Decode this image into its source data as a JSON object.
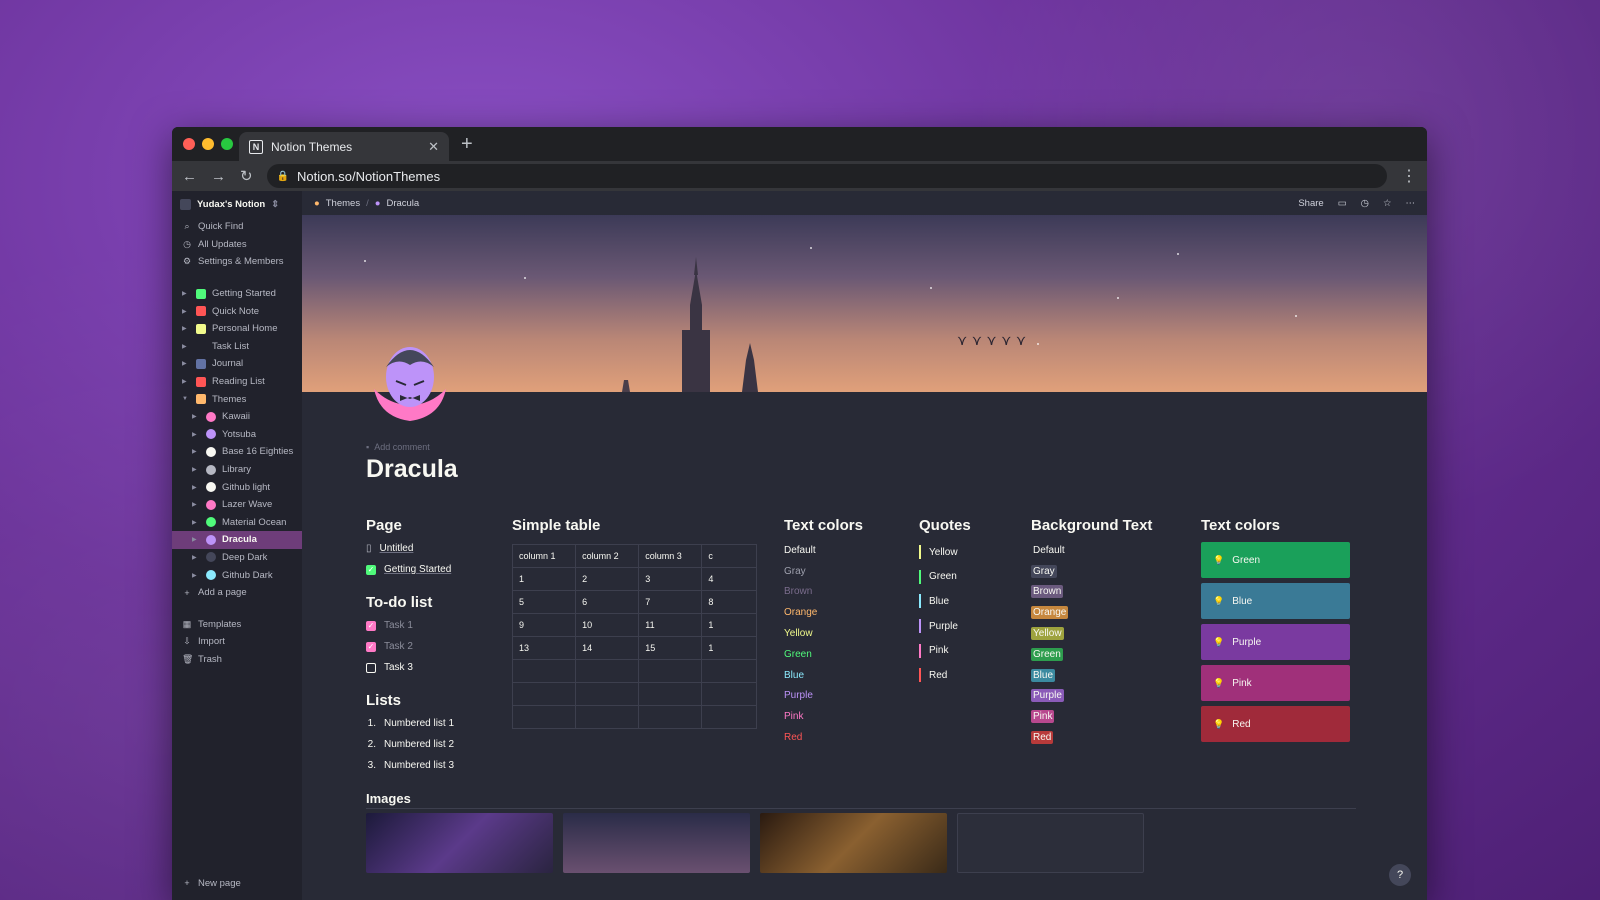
{
  "browser": {
    "tab_title": "Notion Themes",
    "tab_close": "✕",
    "new_tab": "+",
    "url": "Notion.so/NotionThemes"
  },
  "sidebar": {
    "workspace": "Yudax's Notion",
    "actions": [
      {
        "label": "Quick Find",
        "icon": "search-icon"
      },
      {
        "label": "All Updates",
        "icon": "clock-icon"
      },
      {
        "label": "Settings & Members",
        "icon": "gear-icon"
      }
    ],
    "pages": [
      {
        "label": "Getting Started",
        "color": "#50fa7b"
      },
      {
        "label": "Quick Note",
        "color": "#ff5555"
      },
      {
        "label": "Personal Home",
        "color": "#f1fa8c"
      },
      {
        "label": "Task List",
        "color": "#21222c"
      },
      {
        "label": "Journal",
        "color": "#6272a4"
      },
      {
        "label": "Reading List",
        "color": "#ff5555"
      },
      {
        "label": "Themes",
        "color": "#ffb86c"
      }
    ],
    "subpages": [
      {
        "label": "Kawaii",
        "color": "#ff79c6"
      },
      {
        "label": "Yotsuba",
        "color": "#bd93f9"
      },
      {
        "label": "Base 16 Eighties",
        "color": "#f8f8f2"
      },
      {
        "label": "Library",
        "color": "#b6b8c3"
      },
      {
        "label": "Github light",
        "color": "#f8f8f2"
      },
      {
        "label": "Lazer Wave",
        "color": "#ff79c6"
      },
      {
        "label": "Material Ocean",
        "color": "#50fa7b"
      },
      {
        "label": "Dracula",
        "color": "#bd93f9"
      },
      {
        "label": "Deep Dark",
        "color": "#44475a"
      },
      {
        "label": "Github Dark",
        "color": "#8be9fd"
      }
    ],
    "add_page": "Add a page",
    "tools": [
      {
        "label": "Templates",
        "icon": "templates-icon"
      },
      {
        "label": "Import",
        "icon": "import-icon"
      },
      {
        "label": "Trash",
        "icon": "trash-icon"
      }
    ],
    "new_page": "New page"
  },
  "topbar": {
    "crumb1": "Themes",
    "crumb_sep": "/",
    "crumb2": "Dracula",
    "share": "Share"
  },
  "page": {
    "add_comment": "Add comment",
    "title": "Dracula"
  },
  "page_section": {
    "heading": "Page",
    "items": [
      "Untitled",
      "Getting Started"
    ]
  },
  "todo": {
    "heading": "To-do list",
    "items": [
      {
        "label": "Task 1",
        "done": true
      },
      {
        "label": "Task 2",
        "done": true
      },
      {
        "label": "Task 3",
        "done": false
      }
    ]
  },
  "lists": {
    "heading": "Lists",
    "items": [
      "Numbered list 1",
      "Numbered list 2",
      "Numbered list 3"
    ]
  },
  "simple_table": {
    "heading": "Simple table",
    "rows": [
      [
        "column 1",
        "column 2",
        "column 3",
        "c"
      ],
      [
        "1",
        "2",
        "3",
        "4"
      ],
      [
        "5",
        "6",
        "7",
        "8"
      ],
      [
        "9",
        "10",
        "11",
        "1"
      ],
      [
        "13",
        "14",
        "15",
        "1"
      ],
      [
        "",
        "",
        "",
        ""
      ],
      [
        "",
        "",
        "",
        ""
      ],
      [
        "",
        "",
        "",
        ""
      ]
    ]
  },
  "text_colors": {
    "heading": "Text colors",
    "items": [
      {
        "label": "Default",
        "color": "#f8f8f2"
      },
      {
        "label": "Gray",
        "color": "#9ea0ad"
      },
      {
        "label": "Brown",
        "color": "#7a6c8c"
      },
      {
        "label": "Orange",
        "color": "#ffb86c"
      },
      {
        "label": "Yellow",
        "color": "#f1fa8c"
      },
      {
        "label": "Green",
        "color": "#50fa7b"
      },
      {
        "label": "Blue",
        "color": "#8be9fd"
      },
      {
        "label": "Purple",
        "color": "#bd93f9"
      },
      {
        "label": "Pink",
        "color": "#ff79c6"
      },
      {
        "label": "Red",
        "color": "#ff5555"
      }
    ]
  },
  "quotes": {
    "heading": "Quotes",
    "items": [
      {
        "label": "Yellow",
        "color": "#f1fa8c"
      },
      {
        "label": "Green",
        "color": "#50fa7b"
      },
      {
        "label": "Blue",
        "color": "#8be9fd"
      },
      {
        "label": "Purple",
        "color": "#bd93f9"
      },
      {
        "label": "Pink",
        "color": "#ff79c6"
      },
      {
        "label": "Red",
        "color": "#ff5555"
      }
    ]
  },
  "background_text": {
    "heading": "Background Text",
    "items": [
      {
        "label": "Default",
        "bg": "transparent"
      },
      {
        "label": "Gray",
        "bg": "#44475a"
      },
      {
        "label": "Brown",
        "bg": "#6b5a7e"
      },
      {
        "label": "Orange",
        "bg": "#c6873e"
      },
      {
        "label": "Yellow",
        "bg": "#9ea33e"
      },
      {
        "label": "Green",
        "bg": "#2e9d4e"
      },
      {
        "label": "Blue",
        "bg": "#3b8aa0"
      },
      {
        "label": "Purple",
        "bg": "#8a5bb8"
      },
      {
        "label": "Pink",
        "bg": "#b8488e"
      },
      {
        "label": "Red",
        "bg": "#b83a3a"
      }
    ]
  },
  "callouts": {
    "heading": "Text colors",
    "items": [
      {
        "label": "Green",
        "bg": "#1aa05a"
      },
      {
        "label": "Blue",
        "bg": "#3a7a96"
      },
      {
        "label": "Purple",
        "bg": "#7a3aa0"
      },
      {
        "label": "Pink",
        "bg": "#a0307a"
      },
      {
        "label": "Red",
        "bg": "#a02a3a"
      }
    ]
  },
  "images": {
    "heading": "Images"
  },
  "help": "?"
}
